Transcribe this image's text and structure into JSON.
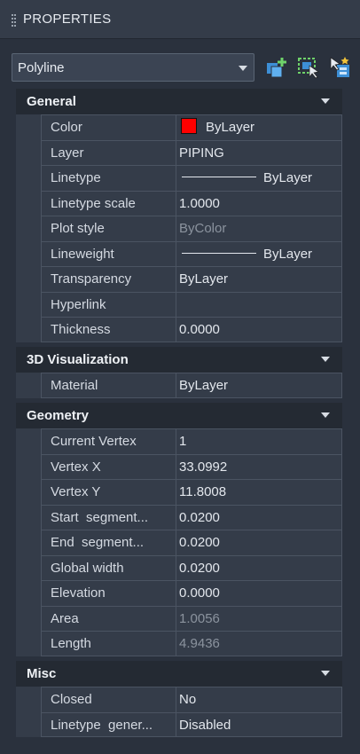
{
  "panel": {
    "title": "PROPERTIES"
  },
  "selector": {
    "value": "Polyline"
  },
  "colors": {
    "swatch": "#ff0000",
    "background": "#2a313d",
    "header": "#242a33"
  },
  "icons": [
    "quick-select-add-icon",
    "select-objects-icon",
    "toggle-pickadd-icon"
  ],
  "sections": {
    "general": {
      "label": "General",
      "rows": {
        "color": {
          "label": "Color",
          "value": "ByLayer"
        },
        "layer": {
          "label": "Layer",
          "value": "PIPING"
        },
        "linetype": {
          "label": "Linetype",
          "value": "ByLayer"
        },
        "ltscale": {
          "label": "Linetype scale",
          "value": "1.0000"
        },
        "plotstyle": {
          "label": "Plot style",
          "value": "ByColor"
        },
        "lineweight": {
          "label": "Lineweight",
          "value": "ByLayer"
        },
        "transparency": {
          "label": "Transparency",
          "value": "ByLayer"
        },
        "hyperlink": {
          "label": "Hyperlink",
          "value": ""
        },
        "thickness": {
          "label": "Thickness",
          "value": "0.0000"
        }
      }
    },
    "viz3d": {
      "label": "3D Visualization",
      "rows": {
        "material": {
          "label": "Material",
          "value": "ByLayer"
        }
      }
    },
    "geometry": {
      "label": "Geometry",
      "rows": {
        "curvertex": {
          "label": "Current Vertex",
          "value": "1"
        },
        "vertexx": {
          "label": "Vertex X",
          "value": "33.0992"
        },
        "vertexy": {
          "label": "Vertex Y",
          "value": "11.8008"
        },
        "startseg": {
          "label": "Start  segment...",
          "value": "0.0200"
        },
        "endseg": {
          "label": "End  segment...",
          "value": "0.0200"
        },
        "globalwidth": {
          "label": "Global width",
          "value": "0.0200"
        },
        "elevation": {
          "label": "Elevation",
          "value": "0.0000"
        },
        "area": {
          "label": "Area",
          "value": "1.0056"
        },
        "length": {
          "label": "Length",
          "value": "4.9436"
        }
      }
    },
    "misc": {
      "label": "Misc",
      "rows": {
        "closed": {
          "label": "Closed",
          "value": "No"
        },
        "ltgen": {
          "label": "Linetype  gener...",
          "value": "Disabled"
        }
      }
    }
  }
}
